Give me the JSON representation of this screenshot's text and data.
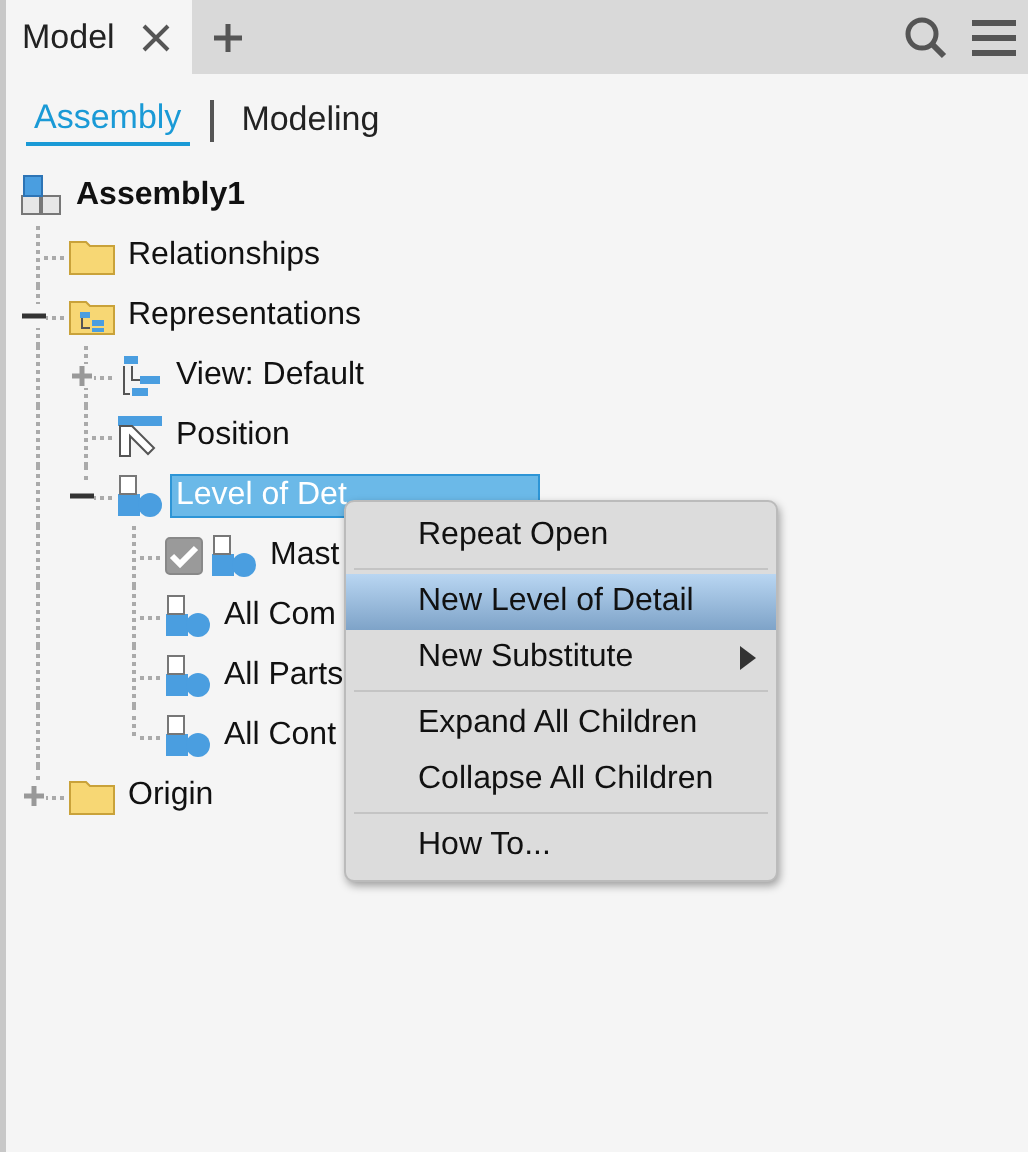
{
  "tabs": [
    {
      "label": "Model",
      "selected": true,
      "closable": true
    }
  ],
  "view_switch": [
    {
      "label": "Assembly",
      "selected": true
    },
    {
      "label": "Modeling",
      "selected": false
    }
  ],
  "tree": [
    {
      "label": "Assembly1",
      "kind": "assembly",
      "bold": true,
      "selected": false,
      "children": [
        {
          "label": "Relationships",
          "kind": "folder",
          "selected": false
        },
        {
          "label": "Representations",
          "kind": "rep-folder",
          "selected": false,
          "expanded": true,
          "children": [
            {
              "label": "View: Default",
              "kind": "view",
              "selected": false,
              "expanded": false
            },
            {
              "label": "Position",
              "kind": "position",
              "selected": false
            },
            {
              "label": "Level of Det",
              "kind": "lod",
              "selected": true,
              "expanded": true,
              "children": [
                {
                  "label": "Mast",
                  "kind": "lod",
                  "selected": false,
                  "checked": true
                },
                {
                  "label": "All Com",
                  "kind": "lod",
                  "selected": false
                },
                {
                  "label": "All Parts",
                  "kind": "lod",
                  "selected": false
                },
                {
                  "label": "All Cont",
                  "kind": "lod",
                  "selected": false
                }
              ]
            }
          ]
        },
        {
          "label": "Origin",
          "kind": "folder",
          "selected": false,
          "expanded": false
        }
      ]
    }
  ],
  "context_menu": [
    {
      "label": "Repeat Open",
      "selected": false,
      "submenu": false
    },
    {
      "kind": "separator"
    },
    {
      "label": "New Level of Detail",
      "selected": true,
      "submenu": false
    },
    {
      "label": "New Substitute",
      "selected": false,
      "submenu": true
    },
    {
      "kind": "separator"
    },
    {
      "label": "Expand All Children",
      "selected": false,
      "submenu": false
    },
    {
      "label": "Collapse All Children",
      "selected": false,
      "submenu": false
    },
    {
      "kind": "separator"
    },
    {
      "label": "How To...",
      "selected": false,
      "submenu": false
    }
  ]
}
